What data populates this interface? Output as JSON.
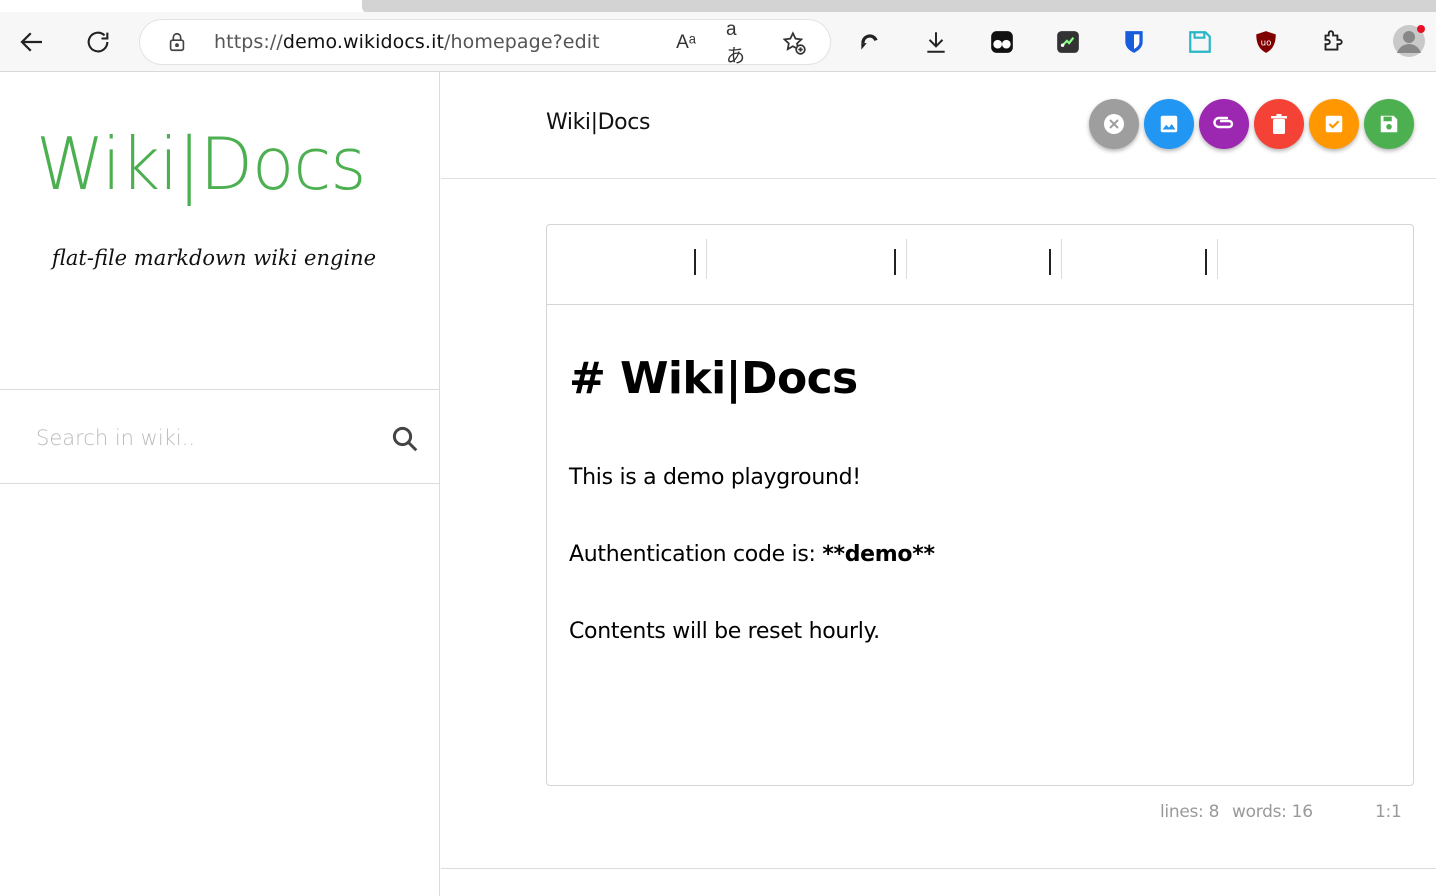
{
  "browser": {
    "url_prefix": "https://",
    "url_host": "demo.wikidocs.it",
    "url_path": "/homepage?edit",
    "read_aloud_icon": "Aᵃ",
    "translate_icon": "aあ"
  },
  "sidebar": {
    "logo_text": "Wiki|Docs",
    "tagline": "flat-file markdown wiki engine",
    "search_placeholder": "Search in wiki.."
  },
  "header": {
    "title": "Wiki|Docs",
    "actions": [
      {
        "name": "close",
        "color": "#9e9e9e"
      },
      {
        "name": "image",
        "color": "#2196f3"
      },
      {
        "name": "attachment",
        "color": "#9c27b0"
      },
      {
        "name": "delete",
        "color": "#f44336"
      },
      {
        "name": "check",
        "color": "#ff9800"
      },
      {
        "name": "save",
        "color": "#4caf50"
      }
    ]
  },
  "editor": {
    "heading": "# Wiki|Docs",
    "line1": "This is a demo playground!",
    "line2_prefix": "Authentication code is: ",
    "line2_bold": "**demo**",
    "line3": "Contents will be reset hourly."
  },
  "status": {
    "lines": "lines: 8",
    "words": "words: 16",
    "cursor": "1:1"
  },
  "colors": {
    "brand_green": "#4caf50"
  }
}
